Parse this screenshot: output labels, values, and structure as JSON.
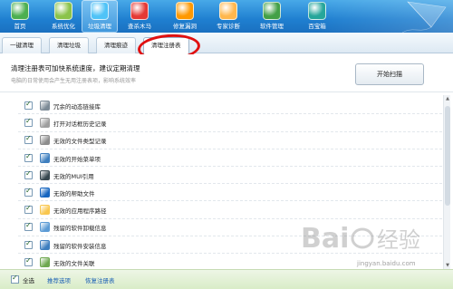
{
  "toolbar": {
    "buttons": [
      {
        "label": "首页",
        "icon": "house-icon",
        "color": "#4caf50"
      },
      {
        "label": "系统优化",
        "icon": "gauge-icon",
        "color": "#8bc34a"
      },
      {
        "label": "垃圾清理",
        "icon": "trash-icon",
        "color": "#4fc3f7",
        "active": true
      },
      {
        "label": "查杀木马",
        "icon": "horse-icon",
        "color": "#e53935"
      },
      {
        "label": "修复漏洞",
        "icon": "patch-icon",
        "color": "#ff9800"
      },
      {
        "label": "专家诊断",
        "icon": "stethoscope-icon",
        "color": "#ffb74d"
      },
      {
        "label": "软件管理",
        "icon": "windows-icon",
        "color": "#43a047"
      },
      {
        "label": "百宝箱",
        "icon": "toolbox-icon",
        "color": "#26a69a"
      }
    ]
  },
  "tabs": [
    {
      "label": "一键清理"
    },
    {
      "label": "清理垃圾"
    },
    {
      "label": "清理痕迹"
    },
    {
      "label": "清理注册表",
      "active": true
    }
  ],
  "header": {
    "title": "清理注册表可加快系统速度，建议定期清理",
    "subtitle": "电脑的日常使用会产生无用注册表项，影响系统效率",
    "scan_button": "开始扫描"
  },
  "list": {
    "items": [
      {
        "label": "冗余的动态链接库",
        "icon": "dll-icon",
        "color": "#7c8a96",
        "checked": true
      },
      {
        "label": "打开对话框历史记录",
        "icon": "dialog-icon",
        "color": "#9e9e9e",
        "checked": true
      },
      {
        "label": "无效的文件类型记录",
        "icon": "filetype-icon",
        "color": "#8d8d8d",
        "checked": true
      },
      {
        "label": "无效的开始菜单项",
        "icon": "start-menu-icon",
        "color": "#3f7fbf",
        "checked": true
      },
      {
        "label": "无效的MUI引用",
        "icon": "mui-icon",
        "color": "#37474f",
        "checked": true
      },
      {
        "label": "无效的帮助文件",
        "icon": "help-icon",
        "color": "#1565c0",
        "checked": true
      },
      {
        "label": "无效的应用程序路径",
        "icon": "folder-icon",
        "color": "#f9c74f",
        "checked": true
      },
      {
        "label": "残留的软件卸载信息",
        "icon": "uninstall-icon",
        "color": "#5c9bd5",
        "checked": true
      },
      {
        "label": "残留的软件安装信息",
        "icon": "install-icon",
        "color": "#3d7ebf",
        "checked": true
      },
      {
        "label": "无效的文件关联",
        "icon": "file-assoc-icon",
        "color": "#6ea84f",
        "checked": true
      }
    ]
  },
  "bottom": {
    "select_all": "全选",
    "select_all_checked": true,
    "recommend": "推荐选项",
    "restore": "恢复注册表"
  },
  "watermark": {
    "logo_text": "Bai 经验",
    "url": "jingyan.baidu.com"
  }
}
